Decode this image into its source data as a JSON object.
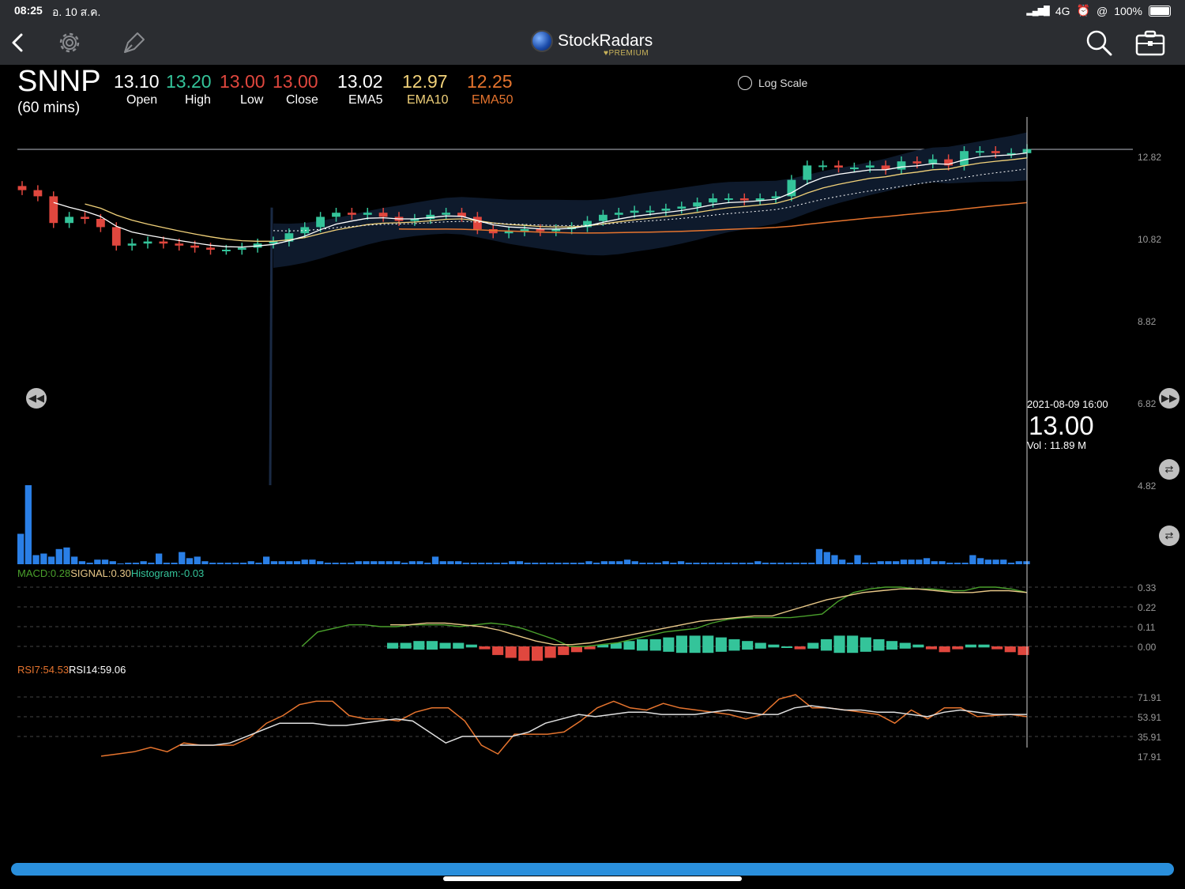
{
  "status_bar": {
    "time": "08:25",
    "date": "อ. 10 ส.ค.",
    "network": "4G",
    "battery": "100%"
  },
  "nav": {
    "back": "back-arrow",
    "settings": "gear-icon",
    "draw": "pen-icon",
    "brand": "StockRadars",
    "brand_sub": "♥PREMIUM",
    "search": "search-icon",
    "portfolio": "briefcase-icon"
  },
  "quote": {
    "symbol": "SNNP",
    "interval": "(60 mins)",
    "open": "13.10",
    "high": "13.20",
    "low": "13.00",
    "close": "13.00",
    "ema5": "13.02",
    "ema10": "12.97",
    "ema50": "12.25",
    "labels": {
      "open": "Open",
      "high": "High",
      "low": "Low",
      "close": "Close",
      "ema5": "EMA5",
      "ema10": "EMA10",
      "ema50": "EMA50"
    }
  },
  "log_scale": {
    "label": "Log Scale",
    "checked": false
  },
  "price_axis": [
    "12.82",
    "10.82",
    "8.82",
    "6.82",
    "4.82"
  ],
  "crosshair": {
    "date": "2021-08-09 16:00",
    "price": "13.00",
    "volume": "Vol   : 11.89 M"
  },
  "macd": {
    "macd": "MACD:0.28",
    "signal": "SIGNAL:0.30",
    "histogram": "Histogram:-0.03",
    "axis": [
      "0.33",
      "0.22",
      "0.11",
      "0.00"
    ]
  },
  "rsi": {
    "rsi7": "RSI7:54.53",
    "rsi14": "RSI14:59.06",
    "axis": [
      "71.91",
      "53.91",
      "35.91",
      "17.91"
    ]
  },
  "colors": {
    "up": "#34c49a",
    "down": "#e0473e",
    "ema5": "#ffffff",
    "ema10": "#f2d27a",
    "ema50": "#e6742e",
    "volume": "#2a7fe6",
    "macd": "#4aa02c",
    "signal": "#e8c888",
    "rsi7": "#e6742e",
    "rsi14": "#e0e0e0",
    "band": "#0e1a2c"
  },
  "chart_data": [
    {
      "type": "line",
      "title": "SNNP (60 mins)",
      "series": [
        {
          "name": "Close",
          "values": [
            12.0,
            11.85,
            11.2,
            11.35,
            11.3,
            11.1,
            10.65,
            10.7,
            10.75,
            10.7,
            10.65,
            10.6,
            10.55,
            10.55,
            10.6,
            10.7,
            10.75,
            10.95,
            11.1,
            11.35,
            11.45,
            11.4,
            11.45,
            11.35,
            11.25,
            11.3,
            11.4,
            11.45,
            11.35,
            11.05,
            10.95,
            11.0,
            11.05,
            11.0,
            11.05,
            11.1,
            11.25,
            11.4,
            11.45,
            11.5,
            11.5,
            11.55,
            11.6,
            11.7,
            11.8,
            11.8,
            11.75,
            11.8,
            11.85,
            12.25,
            12.6,
            12.6,
            12.55,
            12.55,
            12.6,
            12.5,
            12.7,
            12.65,
            12.75,
            12.6,
            12.95,
            12.95,
            12.9,
            12.9,
            13.0
          ]
        },
        {
          "name": "EMA5",
          "values": [
            13.02
          ]
        },
        {
          "name": "EMA10",
          "values": [
            12.97
          ]
        },
        {
          "name": "EMA50",
          "values": [
            12.25
          ]
        }
      ],
      "ylim": [
        4.82,
        12.82
      ]
    },
    {
      "type": "bar",
      "title": "Volume",
      "values": [
        2.0,
        5.2,
        0.6,
        0.7,
        0.5,
        1.0,
        1.1,
        0.5,
        0.2,
        0.1,
        0.3,
        0.3,
        0.2,
        0.05,
        0.1,
        0.1,
        0.2,
        0.1,
        0.7,
        0.1,
        0.1,
        0.8,
        0.4,
        0.5,
        0.2,
        0.1,
        0.1,
        0.1,
        0.1,
        0.1,
        0.2,
        0.1,
        0.5,
        0.2,
        0.2,
        0.2,
        0.2,
        0.3,
        0.3,
        0.2,
        0.1,
        0.1,
        0.1,
        0.1,
        0.2,
        0.2,
        0.2,
        0.2,
        0.2,
        0.2,
        0.1,
        0.2,
        0.2,
        0.1,
        0.5,
        0.2,
        0.2,
        0.2,
        0.1,
        0.1,
        0.1,
        0.1,
        0.1,
        0.1,
        0.2,
        0.2,
        0.1,
        0.1,
        0.1,
        0.1,
        0.1,
        0.1,
        0.1,
        0.1,
        0.2,
        0.1,
        0.2,
        0.2,
        0.2,
        0.3,
        0.2,
        0.1,
        0.1,
        0.1,
        0.2,
        0.1,
        0.2,
        0.1,
        0.1,
        0.1,
        0.1,
        0.1,
        0.1,
        0.1,
        0.1,
        0.1,
        0.2,
        0.1,
        0.1,
        0.1,
        0.1,
        0.1,
        0.1,
        0.1,
        1.0,
        0.8,
        0.6,
        0.3,
        0.1,
        0.6,
        0.1,
        0.1,
        0.2,
        0.2,
        0.2,
        0.3,
        0.3,
        0.3,
        0.4,
        0.2,
        0.2,
        0.1,
        0.1,
        0.1,
        0.6,
        0.4,
        0.3,
        0.3,
        0.3,
        0.1,
        0.2,
        0.2
      ]
    },
    {
      "type": "line",
      "title": "MACD",
      "series": [
        {
          "name": "MACD",
          "values": [
            0.0,
            0.08,
            0.1,
            0.12,
            0.12,
            0.11,
            0.11,
            0.12,
            0.12,
            0.12,
            0.11,
            0.12,
            0.13,
            0.12,
            0.1,
            0.07,
            0.04,
            0.0,
            0.0,
            0.01,
            0.02,
            0.04,
            0.06,
            0.08,
            0.09,
            0.1,
            0.13,
            0.15,
            0.16,
            0.16,
            0.16,
            0.16,
            0.17,
            0.18,
            0.25,
            0.3,
            0.32,
            0.33,
            0.33,
            0.32,
            0.32,
            0.31,
            0.31,
            0.33,
            0.33,
            0.32,
            0.3
          ]
        },
        {
          "name": "SIGNAL",
          "values": [
            0.12,
            0.12,
            0.13,
            0.13,
            0.12,
            0.11,
            0.09,
            0.06,
            0.03,
            0.01,
            0.01,
            0.02,
            0.04,
            0.06,
            0.08,
            0.1,
            0.12,
            0.14,
            0.15,
            0.16,
            0.17,
            0.17,
            0.2,
            0.23,
            0.26,
            0.28,
            0.3,
            0.31,
            0.32,
            0.32,
            0.31,
            0.3,
            0.3,
            0.31,
            0.31,
            0.3
          ]
        },
        {
          "name": "Histogram",
          "values": [
            0.02,
            0.02,
            0.03,
            0.03,
            0.02,
            0.02,
            0.01,
            -0.01,
            -0.03,
            -0.04,
            -0.05,
            -0.05,
            -0.04,
            -0.03,
            -0.02,
            -0.01,
            0.01,
            0.02,
            0.03,
            0.04,
            0.04,
            0.05,
            0.06,
            0.06,
            0.06,
            0.05,
            0.04,
            0.03,
            0.02,
            0.01,
            0.0,
            -0.01,
            0.02,
            0.04,
            0.06,
            0.06,
            0.05,
            0.04,
            0.03,
            0.02,
            0.01,
            -0.01,
            -0.02,
            -0.01,
            0.01,
            0.01,
            -0.01,
            -0.02,
            -0.03
          ]
        }
      ],
      "ylim": [
        0.0,
        0.33
      ]
    },
    {
      "type": "line",
      "title": "RSI",
      "series": [
        {
          "name": "RSI7",
          "values": [
            18,
            20,
            22,
            26,
            22,
            30,
            28,
            28,
            28,
            35,
            48,
            55,
            65,
            68,
            68,
            55,
            52,
            52,
            50,
            58,
            62,
            62,
            50,
            28,
            20,
            38,
            38,
            38,
            40,
            50,
            62,
            68,
            62,
            60,
            66,
            62,
            60,
            58,
            56,
            52,
            56,
            70,
            74,
            62,
            62,
            60,
            58,
            56,
            48,
            60,
            52,
            62,
            62,
            54,
            55,
            56,
            54
          ]
        },
        {
          "name": "RSI14",
          "values": [
            28,
            28,
            28,
            30,
            36,
            42,
            48,
            48,
            48,
            46,
            46,
            48,
            50,
            52,
            50,
            40,
            30,
            36,
            36,
            36,
            36,
            40,
            48,
            52,
            56,
            54,
            56,
            58,
            58,
            56,
            56,
            56,
            58,
            60,
            58,
            56,
            56,
            62,
            64,
            62,
            60,
            60,
            58,
            58,
            56,
            54,
            58,
            60,
            58,
            56,
            56,
            56
          ]
        }
      ],
      "ylim": [
        17.91,
        71.91
      ]
    }
  ]
}
